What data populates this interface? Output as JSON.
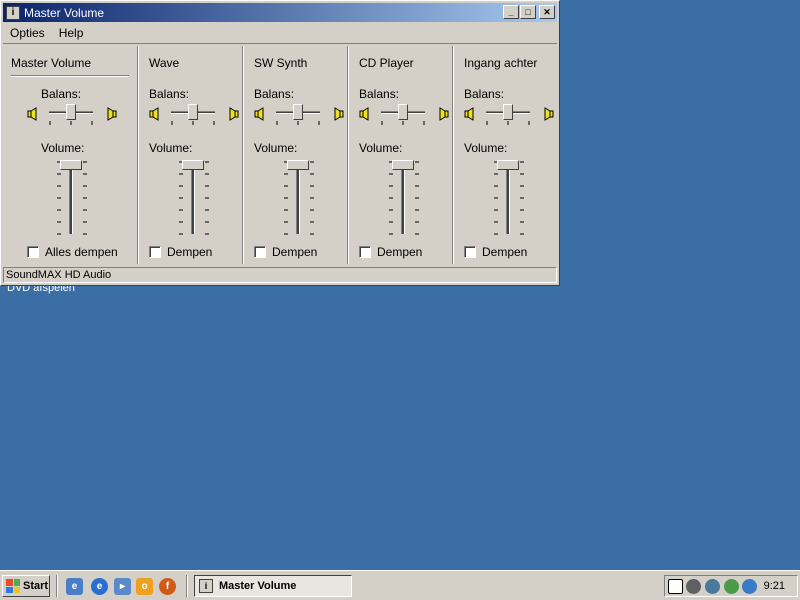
{
  "window": {
    "title": "Master Volume",
    "icon_glyph": "i",
    "buttons": [
      "_",
      "□",
      "✕"
    ]
  },
  "menu": [
    "Opties",
    "Help"
  ],
  "channels": [
    {
      "name": "Master Volume",
      "balance_label": "Balans:",
      "volume_label": "Volume:",
      "mute_label": "Alles dempen",
      "muted": false,
      "balance": 0.5,
      "volume": 1.0
    },
    {
      "name": "Wave",
      "balance_label": "Balans:",
      "volume_label": "Volume:",
      "mute_label": "Dempen",
      "muted": false,
      "balance": 0.5,
      "volume": 1.0
    },
    {
      "name": "SW Synth",
      "balance_label": "Balans:",
      "volume_label": "Volume:",
      "mute_label": "Dempen",
      "muted": false,
      "balance": 0.5,
      "volume": 1.0
    },
    {
      "name": "CD Player",
      "balance_label": "Balans:",
      "volume_label": "Volume:",
      "mute_label": "Dempen",
      "muted": false,
      "balance": 0.5,
      "volume": 1.0
    },
    {
      "name": "Ingang achter",
      "balance_label": "Balans:",
      "volume_label": "Volume:",
      "mute_label": "Dempen",
      "muted": false,
      "balance": 0.5,
      "volume": 1.0
    }
  ],
  "status": "SoundMAX HD Audio",
  "desktop_label": "DVD afspelen",
  "taskbar": {
    "start_label": "Start",
    "task_label": "Master Volume",
    "clock": "9:21"
  },
  "colors": {
    "desktop": "#3a6ea5",
    "title_start": "#0a246a",
    "title_end": "#a6caf0",
    "face": "#d4d0c8"
  }
}
